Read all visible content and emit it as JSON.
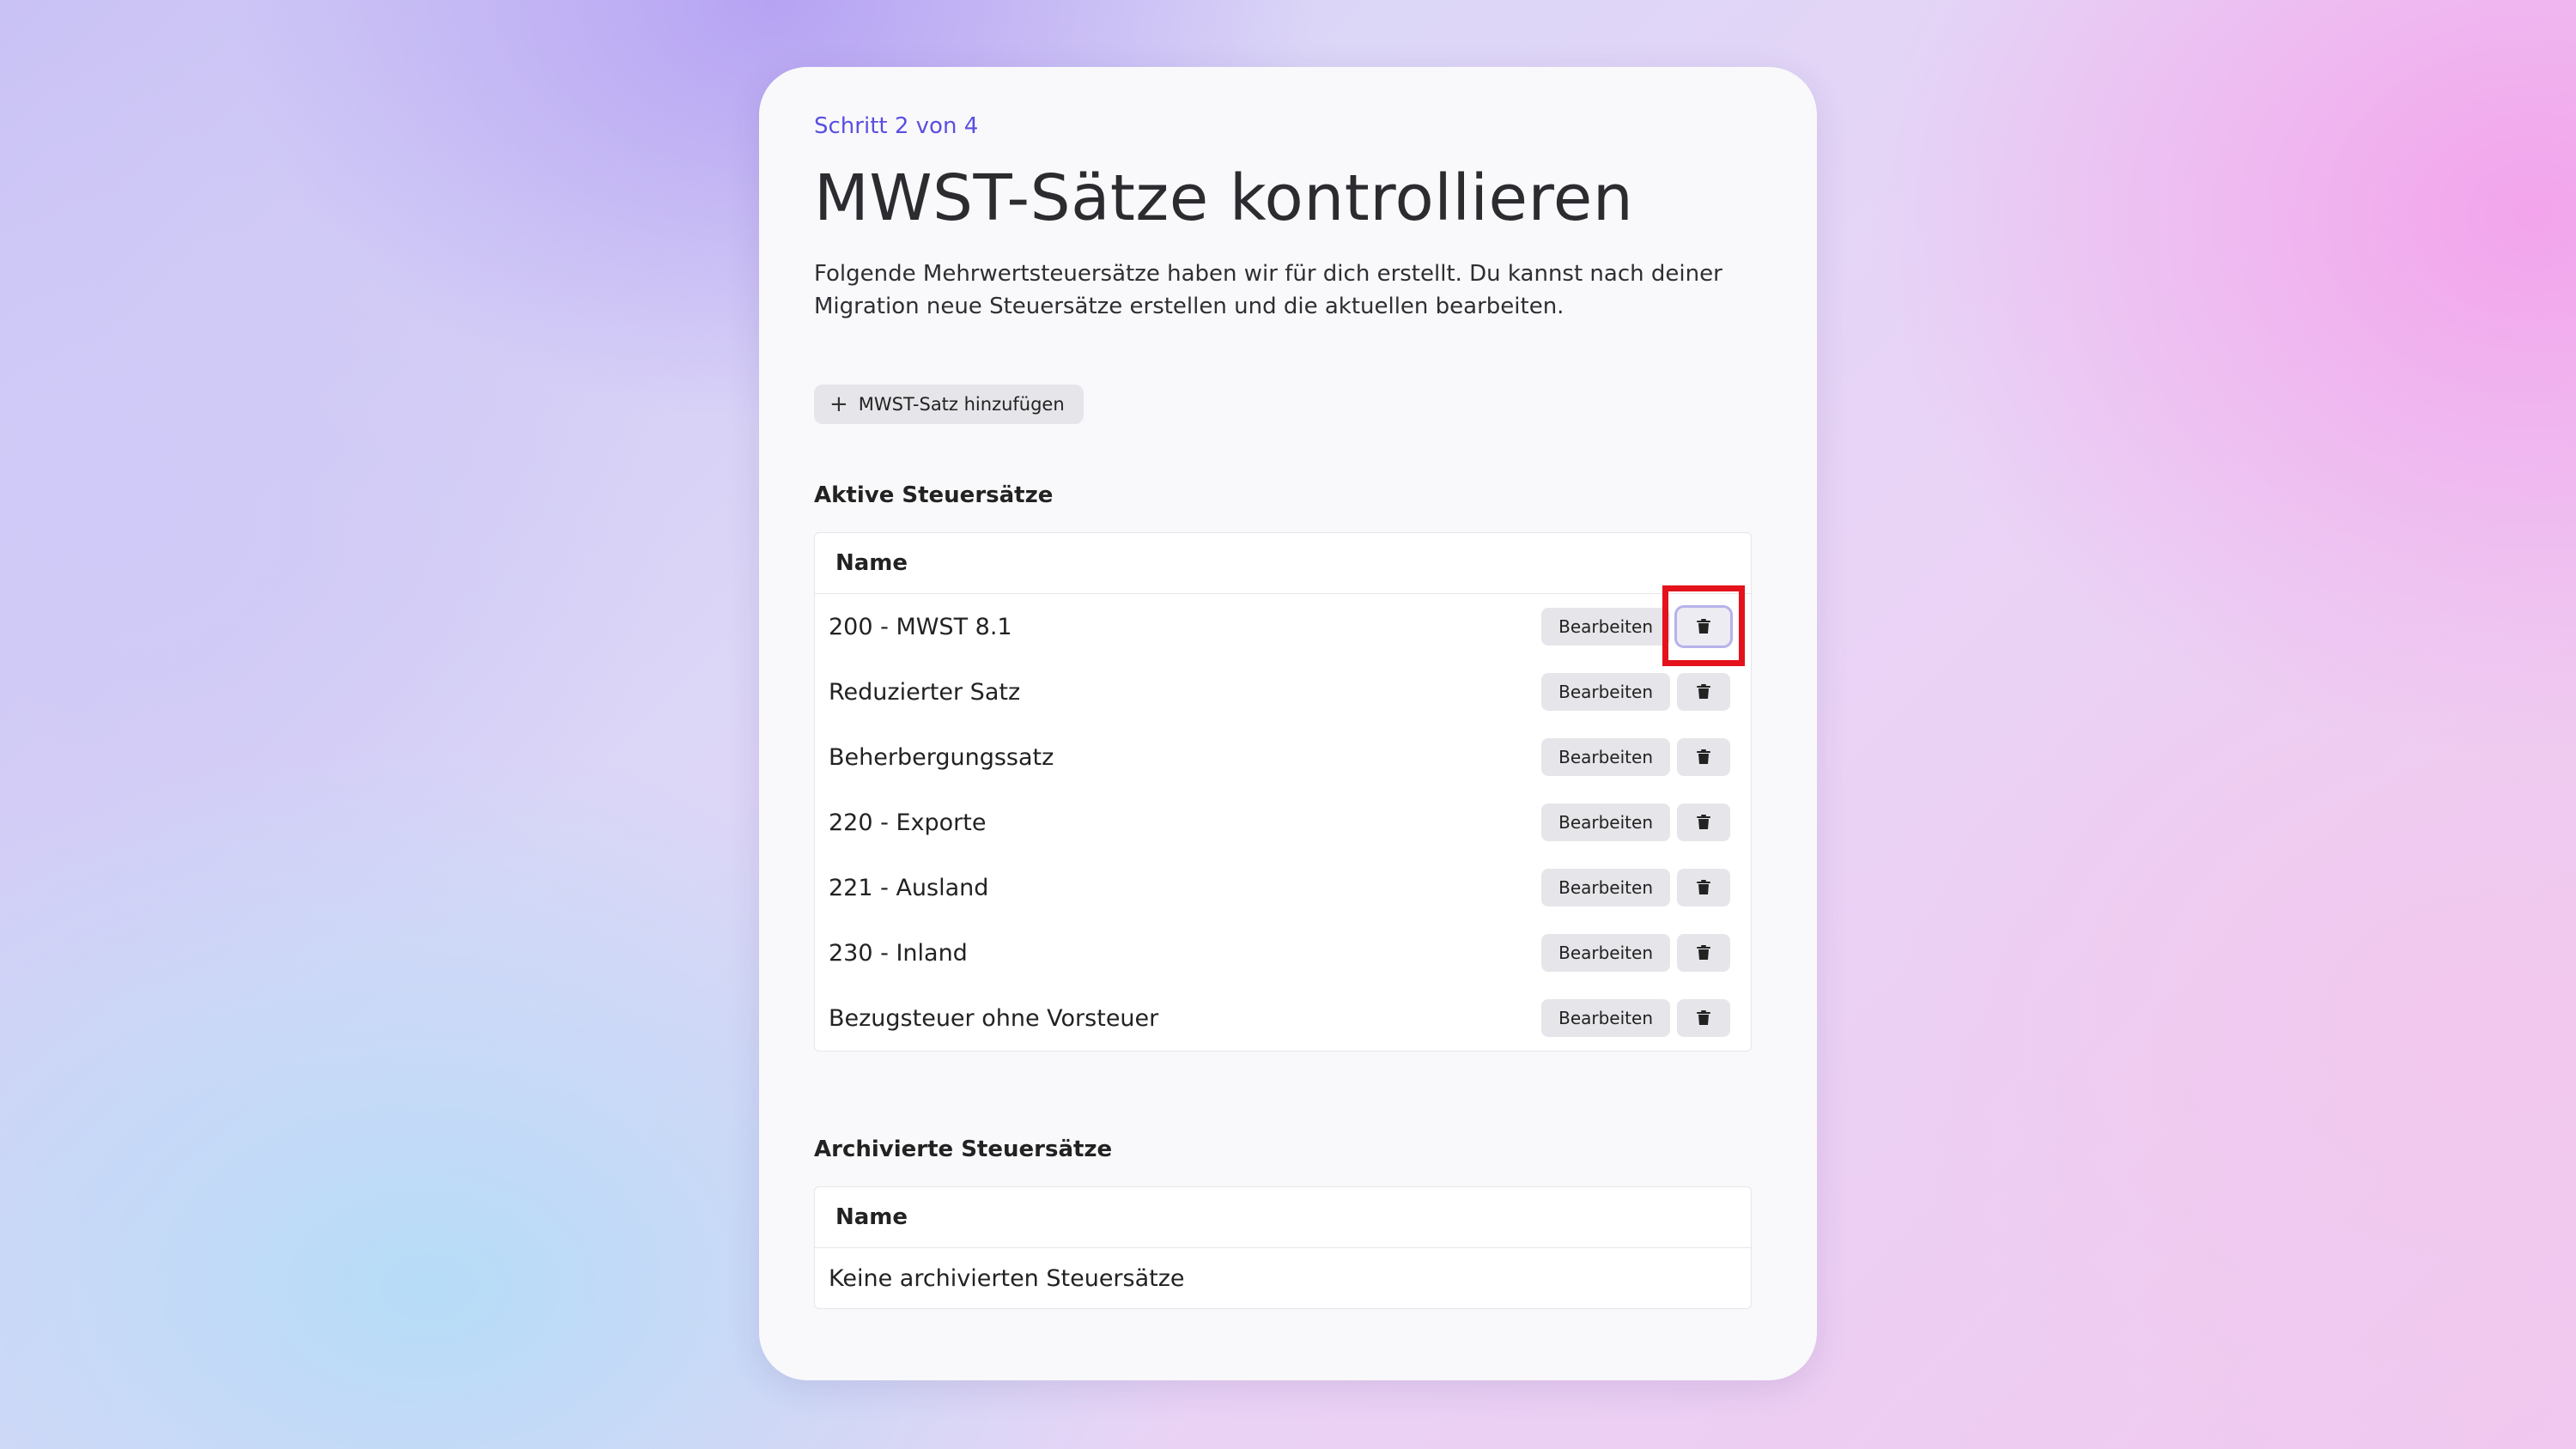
{
  "wizard": {
    "step_label": "Schritt 2 von 4",
    "title": "MWST-Sätze kontrollieren",
    "description": "Folgende Mehrwertsteuersätze haben wir für dich erstellt. Du kannst nach deiner Migration neue Steuersätze erstellen und die aktuellen bearbeiten.",
    "add_button": {
      "icon": "plus-icon",
      "label": "MWST-Satz hinzufügen"
    }
  },
  "active": {
    "section_title": "Aktive Steuersätze",
    "column_header": "Name",
    "edit_label": "Bearbeiten",
    "delete_icon": "trash-icon",
    "rows": [
      {
        "name": "200 - MWST 8.1"
      },
      {
        "name": "Reduzierter Satz"
      },
      {
        "name": "Beherbergungssatz"
      },
      {
        "name": "220 - Exporte"
      },
      {
        "name": "221 - Ausland"
      },
      {
        "name": "230 - Inland"
      },
      {
        "name": "Bezugsteuer ohne Vorsteuer"
      }
    ]
  },
  "archived": {
    "section_title": "Archivierte Steuersätze",
    "column_header": "Name",
    "empty_text": "Keine archivierten Steuersätze"
  },
  "colors": {
    "accent": "#5a4fe0",
    "highlight": "#e3121b"
  }
}
